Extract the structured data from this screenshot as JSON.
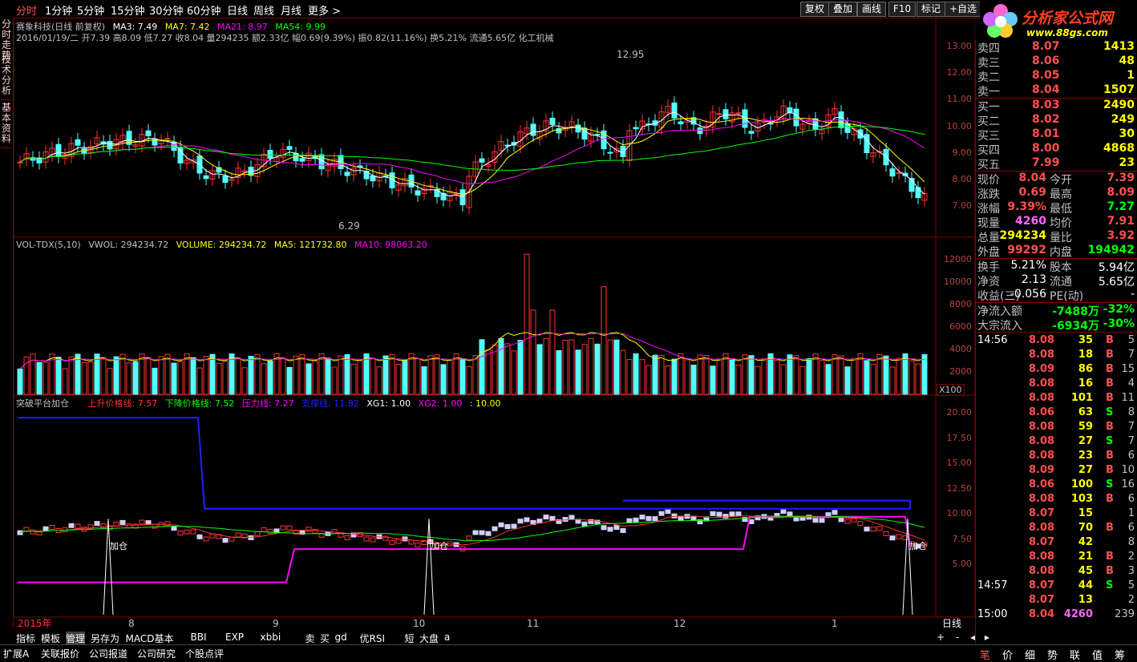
{
  "topbar": {
    "periods": [
      "分时",
      "1分钟",
      "5分钟",
      "15分钟",
      "30分钟",
      "60分钟",
      "日线",
      "周线",
      "月线",
      "更多 >"
    ],
    "right_buttons": [
      "复权",
      "叠加",
      "画线",
      "F10",
      "标记",
      "+自选"
    ],
    "logo": "分析家公式网",
    "logo_url": "www.88gs.com"
  },
  "left_tabs": [
    "分时走势",
    "技术分析",
    "基本资料"
  ],
  "main_chart": {
    "title": "赛象科技(日线 前复权)",
    "ma_labels": [
      "MA3: 7.49",
      "MA7: 7.42",
      "MA21: 8.97",
      "MA54: 9.99"
    ],
    "info_line": "2016/01/19/二 开7.39 高8.09 低7.27 收8.04 量294235 额2.33亿 幅0.69(9.39%) 振0.82(11.16%) 换5.21% 流通5.65亿 化工机械",
    "high_mark": "12.95",
    "low_mark": "6.29",
    "y_ticks": [
      "13.00",
      "12.00",
      "11.00",
      "10.00",
      "9.00",
      "8.00",
      "7.00"
    ]
  },
  "vol_chart": {
    "title": "VOL-TDX(5,10)",
    "vwol": "VWOL: 294234.72",
    "volume": "VOLUME: 294234.72",
    "ma5": "MA5: 121732.80",
    "ma10": "MA10: 98063.20",
    "y_ticks": [
      "12000",
      "10000",
      "8000",
      "6000",
      "4000",
      "2000"
    ],
    "unit": "X100"
  },
  "ind_chart": {
    "title": "突破平台加仓",
    "up": "上升价格线: 7.57",
    "down": "下降价格线: 7.52",
    "press": "压力线: 7.27",
    "support": "支撑线: 11.82",
    "xg1": "XG1: 1.00",
    "xg2": "XG2: 1.00",
    "num": ": 10.00",
    "y_ticks": [
      "20.00",
      "17.50",
      "15.00",
      "12.50",
      "10.00",
      "7.50",
      "5.00"
    ],
    "tag": "加仓"
  },
  "x_axis": {
    "labels": [
      "2015年",
      "8",
      "9",
      "10",
      "11",
      "12",
      "1"
    ],
    "period": "日线"
  },
  "bottom_tabs": [
    "指标",
    "模板",
    "管理",
    "另存为",
    "MACD基本",
    "BBI",
    "EXP",
    "xbbi",
    "卖",
    "买",
    "gd",
    "优RSI",
    "短",
    "大盘",
    "a"
  ],
  "status_items": [
    "扩展A",
    "关联报价",
    "公司报道",
    "公司研究",
    "个股点评"
  ],
  "orderbook": {
    "asks": [
      {
        "label": "卖四",
        "price": "8.07",
        "vol": "1413"
      },
      {
        "label": "卖三",
        "price": "8.06",
        "vol": "48"
      },
      {
        "label": "卖二",
        "price": "8.05",
        "vol": "1"
      },
      {
        "label": "卖一",
        "price": "8.04",
        "vol": "1507"
      }
    ],
    "bids": [
      {
        "label": "买一",
        "price": "8.03",
        "vol": "2490"
      },
      {
        "label": "买二",
        "price": "8.02",
        "vol": "249"
      },
      {
        "label": "买三",
        "price": "8.01",
        "vol": "30"
      },
      {
        "label": "买四",
        "price": "8.00",
        "vol": "4868"
      },
      {
        "label": "买五",
        "price": "7.99",
        "vol": "23"
      }
    ]
  },
  "quote": [
    {
      "l": "现价",
      "v": "8.04",
      "l2": "今开",
      "v2": "7.39"
    },
    {
      "l": "涨跌",
      "v": "0.69",
      "l2": "最高",
      "v2": "8.09"
    },
    {
      "l": "涨幅",
      "v": "9.39%",
      "l2": "最低",
      "v2": "7.27"
    },
    {
      "l": "现量",
      "v": "4260",
      "l2": "均价",
      "v2": "7.91"
    },
    {
      "l": "总量",
      "v": "294234",
      "l2": "量比",
      "v2": "3.92"
    },
    {
      "l": "外盘",
      "v": "99292",
      "l2": "内盘",
      "v2": "194942"
    }
  ],
  "fundamentals": [
    {
      "l": "换手",
      "v": "5.21%",
      "l2": "股本",
      "v2": "5.94亿"
    },
    {
      "l": "净资",
      "v": "2.13",
      "l2": "流通",
      "v2": "5.65亿"
    },
    {
      "l": "收益(三)",
      "v": "-0.056",
      "l2": "PE(动)",
      "v2": "-"
    }
  ],
  "flows": [
    {
      "l": "净流入额",
      "v": "-7488万",
      "p": "-32%"
    },
    {
      "l": "大宗流入",
      "v": "-6934万",
      "p": "-30%"
    }
  ],
  "ticks": [
    {
      "t": "14:56",
      "p": "8.08",
      "v": "35",
      "s": "B",
      "n": "5"
    },
    {
      "t": "",
      "p": "8.08",
      "v": "18",
      "s": "B",
      "n": "7"
    },
    {
      "t": "",
      "p": "8.09",
      "v": "86",
      "s": "B",
      "n": "15"
    },
    {
      "t": "",
      "p": "8.08",
      "v": "16",
      "s": "B",
      "n": "4"
    },
    {
      "t": "",
      "p": "8.08",
      "v": "101",
      "s": "B",
      "n": "11"
    },
    {
      "t": "",
      "p": "8.06",
      "v": "63",
      "s": "S",
      "n": "8"
    },
    {
      "t": "",
      "p": "8.08",
      "v": "59",
      "s": "B",
      "n": "7"
    },
    {
      "t": "",
      "p": "8.08",
      "v": "27",
      "s": "S",
      "n": "7"
    },
    {
      "t": "",
      "p": "8.08",
      "v": "23",
      "s": "B",
      "n": "6"
    },
    {
      "t": "",
      "p": "8.09",
      "v": "27",
      "s": "B",
      "n": "10"
    },
    {
      "t": "",
      "p": "8.06",
      "v": "100",
      "s": "S",
      "n": "16"
    },
    {
      "t": "",
      "p": "8.08",
      "v": "103",
      "s": "B",
      "n": "6"
    },
    {
      "t": "",
      "p": "8.07",
      "v": "15",
      "s": "",
      "n": "1"
    },
    {
      "t": "",
      "p": "8.08",
      "v": "70",
      "s": "B",
      "n": "6"
    },
    {
      "t": "",
      "p": "8.07",
      "v": "42",
      "s": "",
      "n": "8"
    },
    {
      "t": "",
      "p": "8.08",
      "v": "21",
      "s": "B",
      "n": "2"
    },
    {
      "t": "",
      "p": "8.08",
      "v": "45",
      "s": "B",
      "n": "3"
    },
    {
      "t": "14:57",
      "p": "8.07",
      "v": "44",
      "s": "S",
      "n": "5"
    },
    {
      "t": "",
      "p": "8.07",
      "v": "13",
      "s": "",
      "n": "2"
    },
    {
      "t": "15:00",
      "p": "8.04",
      "v": "4260",
      "s": "",
      "n": "239"
    }
  ],
  "rp_bottom": [
    "笔",
    "价",
    "细",
    "势",
    "联",
    "值",
    "筹"
  ],
  "colors": {
    "up": "#ff3232",
    "down": "#54ffff",
    "ma3": "#ffffff",
    "ma7": "#ffff00",
    "ma21": "#ff00ff",
    "ma54": "#00ff00",
    "frame": "#800000"
  }
}
